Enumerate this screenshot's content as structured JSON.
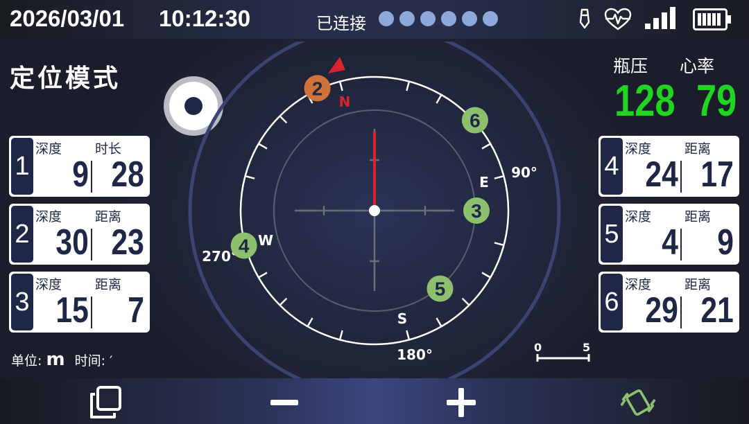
{
  "status": {
    "date": "2026/03/01",
    "time": "10:12:30",
    "connection_label": "已连接",
    "connected_dots": 6,
    "icons": [
      "pen-icon",
      "heartbeat-icon",
      "signal-icon",
      "battery-icon"
    ],
    "accent_color": "#8da9d9"
  },
  "mode": {
    "title": "定位模式"
  },
  "record_button": {
    "icon": "record-icon"
  },
  "left_cards": [
    {
      "index": "1",
      "label1": "深度",
      "value1": "9",
      "label2": "时长",
      "value2": "28"
    },
    {
      "index": "2",
      "label1": "深度",
      "value1": "30",
      "label2": "距离",
      "value2": "23"
    },
    {
      "index": "3",
      "label1": "深度",
      "value1": "15",
      "label2": "距离",
      "value2": "7"
    }
  ],
  "right_cards": [
    {
      "index": "4",
      "label1": "深度",
      "value1": "24",
      "label2": "距离",
      "value2": "17"
    },
    {
      "index": "5",
      "label1": "深度",
      "value1": "4",
      "label2": "距离",
      "value2": "9"
    },
    {
      "index": "6",
      "label1": "深度",
      "value1": "29",
      "label2": "距离",
      "value2": "21"
    }
  ],
  "footer": {
    "unit_label": "单位:",
    "unit_value": "m",
    "time_label": "时间:",
    "time_value": "′"
  },
  "vitals": {
    "pressure_label": "瓶压",
    "pressure_value": "128",
    "heart_label": "心率",
    "heart_value": "79",
    "value_color": "#22d422"
  },
  "compass": {
    "north": "N",
    "east": "E",
    "south": "S",
    "west": "W",
    "deg90": "90°",
    "deg180": "180°",
    "deg270": "270°",
    "heading_deg": 0,
    "markers": [
      {
        "id": "2",
        "bearing": -25,
        "ring": "outer",
        "color": "#d0733a"
      },
      {
        "id": "6",
        "bearing": 48,
        "ring": "outer",
        "color": "#8cc06c"
      },
      {
        "id": "3",
        "bearing": 90,
        "ring": "inner",
        "color": "#8cc06c"
      },
      {
        "id": "4",
        "bearing": -105,
        "ring": "outer",
        "color": "#8cc06c"
      },
      {
        "id": "5",
        "bearing": 140,
        "ring": "inner",
        "color": "#8cc06c"
      }
    ],
    "needle_color": "#d8242c"
  },
  "scale": {
    "min": "0",
    "max": "5"
  },
  "toolbar": {
    "buttons": [
      {
        "name": "copy-button",
        "icon": "copy-icon"
      },
      {
        "name": "zoom-out-button",
        "icon": "minus-icon"
      },
      {
        "name": "zoom-in-button",
        "icon": "plus-icon"
      },
      {
        "name": "vibrate-button",
        "icon": "vibrate-icon",
        "color": "#8cc06c"
      }
    ]
  }
}
